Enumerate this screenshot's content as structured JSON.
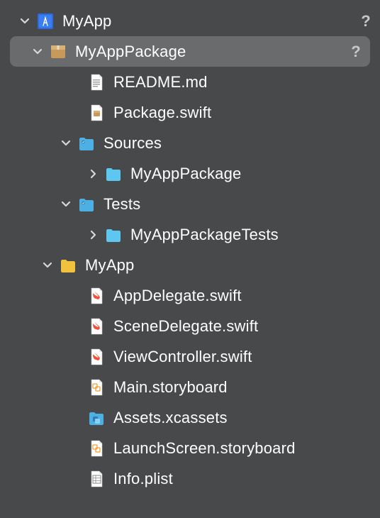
{
  "tree": {
    "root": {
      "label": "MyApp",
      "status": "?"
    },
    "package": {
      "label": "MyAppPackage",
      "status": "?"
    },
    "readme": {
      "label": "README.md"
    },
    "packageSwift": {
      "label": "Package.swift"
    },
    "sources": {
      "label": "Sources"
    },
    "sourcesPkg": {
      "label": "MyAppPackage"
    },
    "tests": {
      "label": "Tests"
    },
    "testsPkg": {
      "label": "MyAppPackageTests"
    },
    "myappFolder": {
      "label": "MyApp"
    },
    "appDelegate": {
      "label": "AppDelegate.swift"
    },
    "sceneDelegate": {
      "label": "SceneDelegate.swift"
    },
    "viewController": {
      "label": "ViewController.swift"
    },
    "mainStoryboard": {
      "label": "Main.storyboard"
    },
    "assets": {
      "label": "Assets.xcassets"
    },
    "launchScreen": {
      "label": "LaunchScreen.storyboard"
    },
    "infoPlist": {
      "label": "Info.plist"
    }
  }
}
